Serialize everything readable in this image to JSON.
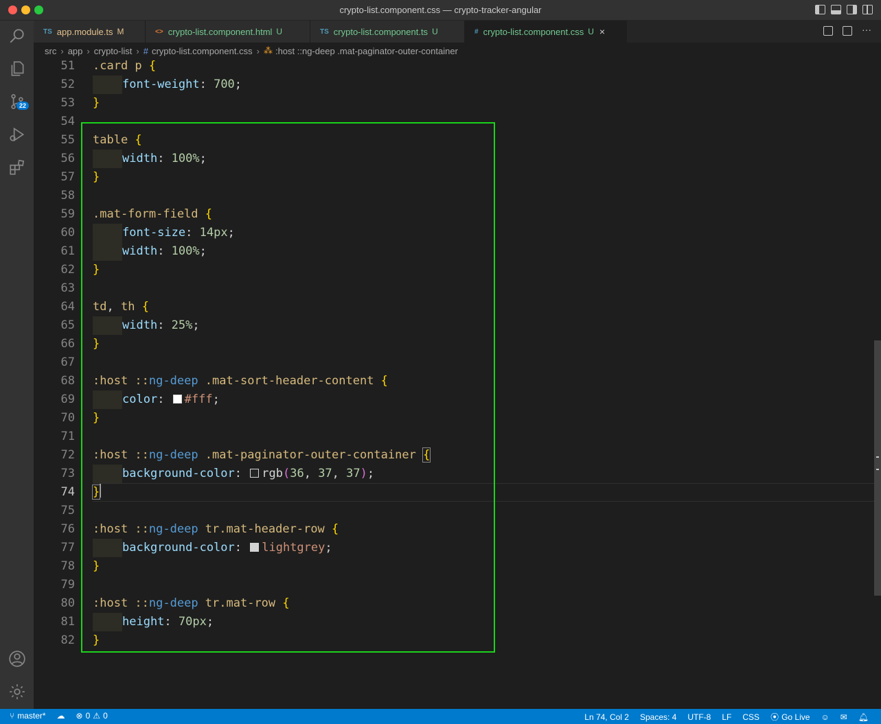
{
  "window": {
    "title": "crypto-list.component.css — crypto-tracker-angular"
  },
  "activity": {
    "scm_badge": "22"
  },
  "tabs": [
    {
      "icon": "TS",
      "name": "app.module.ts",
      "status": "M",
      "state": "modified"
    },
    {
      "icon": "<>",
      "name": "crypto-list.component.html",
      "status": "U",
      "state": "untracked"
    },
    {
      "icon": "TS",
      "name": "crypto-list.component.ts",
      "status": "U",
      "state": "untracked"
    },
    {
      "icon": "#",
      "name": "crypto-list.component.css",
      "status": "U",
      "state": "untracked",
      "active": true
    }
  ],
  "breadcrumb": {
    "parts": [
      "src",
      "app",
      "crypto-list",
      "crypto-list.component.css",
      ":host ::ng-deep .mat-paginator-outer-container"
    ]
  },
  "editor": {
    "current_line": 74,
    "lines": [
      {
        "n": "51",
        "tokens": [
          [
            "sel",
            ".card p "
          ],
          [
            "br",
            "{"
          ]
        ]
      },
      {
        "n": "52",
        "indent": 1,
        "tokens": [
          [
            "prop",
            "font-weight"
          ],
          [
            "pun",
            ": "
          ],
          [
            "num",
            "700"
          ],
          [
            "pun",
            ";"
          ]
        ]
      },
      {
        "n": "53",
        "tokens": [
          [
            "br",
            "}"
          ]
        ]
      },
      {
        "n": "54",
        "tokens": []
      },
      {
        "n": "55",
        "tokens": [
          [
            "sel",
            "table "
          ],
          [
            "br",
            "{"
          ]
        ]
      },
      {
        "n": "56",
        "indent": 1,
        "tokens": [
          [
            "prop",
            "width"
          ],
          [
            "pun",
            ": "
          ],
          [
            "num",
            "100%"
          ],
          [
            "pun",
            ";"
          ]
        ]
      },
      {
        "n": "57",
        "tokens": [
          [
            "br",
            "}"
          ]
        ]
      },
      {
        "n": "58",
        "tokens": []
      },
      {
        "n": "59",
        "tokens": [
          [
            "sel",
            ".mat-form-field "
          ],
          [
            "br",
            "{"
          ]
        ]
      },
      {
        "n": "60",
        "indent": 1,
        "tokens": [
          [
            "prop",
            "font-size"
          ],
          [
            "pun",
            ": "
          ],
          [
            "num",
            "14px"
          ],
          [
            "pun",
            ";"
          ]
        ]
      },
      {
        "n": "61",
        "indent": 1,
        "tokens": [
          [
            "prop",
            "width"
          ],
          [
            "pun",
            ": "
          ],
          [
            "num",
            "100%"
          ],
          [
            "pun",
            ";"
          ]
        ]
      },
      {
        "n": "62",
        "tokens": [
          [
            "br",
            "}"
          ]
        ]
      },
      {
        "n": "63",
        "tokens": []
      },
      {
        "n": "64",
        "tokens": [
          [
            "sel",
            "td"
          ],
          [
            "pun",
            ", "
          ],
          [
            "sel",
            "th "
          ],
          [
            "br",
            "{"
          ]
        ]
      },
      {
        "n": "65",
        "indent": 1,
        "tokens": [
          [
            "prop",
            "width"
          ],
          [
            "pun",
            ": "
          ],
          [
            "num",
            "25%"
          ],
          [
            "pun",
            ";"
          ]
        ]
      },
      {
        "n": "66",
        "tokens": [
          [
            "br",
            "}"
          ]
        ]
      },
      {
        "n": "67",
        "tokens": []
      },
      {
        "n": "68",
        "tokens": [
          [
            "sel",
            ":host "
          ],
          [
            "sel",
            "::"
          ],
          [
            "kw",
            "ng-deep"
          ],
          [
            "sel",
            " .mat-sort-header-content "
          ],
          [
            "br",
            "{"
          ]
        ]
      },
      {
        "n": "69",
        "indent": 1,
        "tokens": [
          [
            "prop",
            "color"
          ],
          [
            "pun",
            ": "
          ],
          [
            "swatch",
            "#ffffff"
          ],
          [
            "str",
            "#fff"
          ],
          [
            "pun",
            ";"
          ]
        ]
      },
      {
        "n": "70",
        "tokens": [
          [
            "br",
            "}"
          ]
        ]
      },
      {
        "n": "71",
        "tokens": []
      },
      {
        "n": "72",
        "tokens": [
          [
            "sel",
            ":host "
          ],
          [
            "sel",
            "::"
          ],
          [
            "kw",
            "ng-deep"
          ],
          [
            "sel",
            " .mat-paginator-outer-container "
          ],
          [
            "brbox",
            "{"
          ]
        ]
      },
      {
        "n": "73",
        "indent": 1,
        "tokens": [
          [
            "prop",
            "background-color"
          ],
          [
            "pun",
            ": "
          ],
          [
            "swatch",
            "#242525"
          ],
          [
            "pun",
            "rgb"
          ],
          [
            "br2",
            "("
          ],
          [
            "num",
            "36"
          ],
          [
            "pun",
            ", "
          ],
          [
            "num",
            "37"
          ],
          [
            "pun",
            ", "
          ],
          [
            "num",
            "37"
          ],
          [
            "br2",
            ")"
          ],
          [
            "pun",
            ";"
          ]
        ]
      },
      {
        "n": "74",
        "tokens": [
          [
            "brbox",
            "}"
          ],
          [
            "cursor",
            ""
          ]
        ]
      },
      {
        "n": "75",
        "tokens": []
      },
      {
        "n": "76",
        "tokens": [
          [
            "sel",
            ":host "
          ],
          [
            "sel",
            "::"
          ],
          [
            "kw",
            "ng-deep"
          ],
          [
            "sel",
            " tr.mat-header-row "
          ],
          [
            "br",
            "{"
          ]
        ]
      },
      {
        "n": "77",
        "indent": 1,
        "tokens": [
          [
            "prop",
            "background-color"
          ],
          [
            "pun",
            ": "
          ],
          [
            "swatch",
            "#d3d3d3"
          ],
          [
            "str",
            "lightgrey"
          ],
          [
            "pun",
            ";"
          ]
        ]
      },
      {
        "n": "78",
        "tokens": [
          [
            "br",
            "}"
          ]
        ]
      },
      {
        "n": "79",
        "tokens": []
      },
      {
        "n": "80",
        "tokens": [
          [
            "sel",
            ":host "
          ],
          [
            "sel",
            "::"
          ],
          [
            "kw",
            "ng-deep"
          ],
          [
            "sel",
            " tr.mat-row "
          ],
          [
            "br",
            "{"
          ]
        ]
      },
      {
        "n": "81",
        "indent": 1,
        "tokens": [
          [
            "prop",
            "height"
          ],
          [
            "pun",
            ": "
          ],
          [
            "num",
            "70px"
          ],
          [
            "pun",
            ";"
          ]
        ]
      },
      {
        "n": "82",
        "tokens": [
          [
            "br",
            "}"
          ]
        ]
      }
    ]
  },
  "statusbar": {
    "branch": "master*",
    "problems": "0",
    "warnings": "0",
    "position": "Ln 74, Col 2",
    "spaces": "Spaces: 4",
    "encoding": "UTF-8",
    "eol": "LF",
    "language": "CSS",
    "golive": "Go Live"
  },
  "colors": {
    "accent": "#007acc",
    "highlight_box": "#1bd41b"
  }
}
